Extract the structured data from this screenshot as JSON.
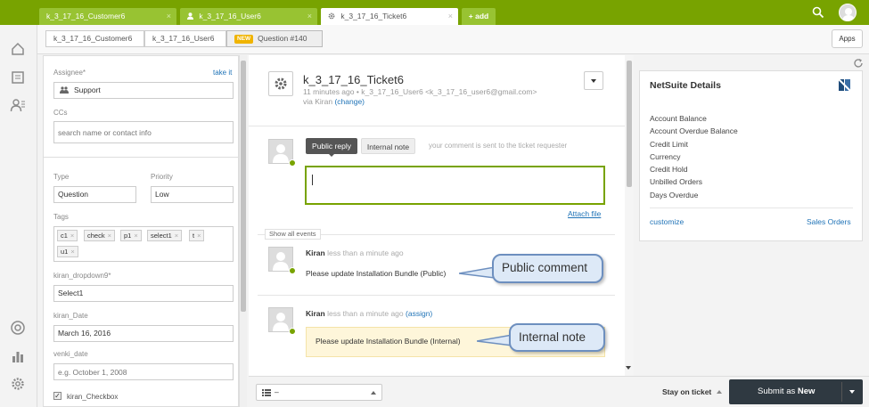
{
  "tabs": [
    {
      "label": "k_3_17_16_Customer6",
      "close": "×"
    },
    {
      "label": "k_3_17_16_User6",
      "close": "×"
    },
    {
      "label": "k_3_17_16_Ticket6",
      "close": "×"
    }
  ],
  "add_tab_label": "+ add",
  "breadcrumbs": {
    "customer": "k_3_17_16_Customer6",
    "user": "k_3_17_16_User6",
    "new_badge": "NEW",
    "question": "Question #140"
  },
  "apps_label": "Apps",
  "props": {
    "assignee_label": "Assignee*",
    "take_it": "take it",
    "assignee_value": "Support",
    "ccs_label": "CCs",
    "ccs_placeholder": "search name or contact info",
    "type_label": "Type",
    "type_value": "Question",
    "priority_label": "Priority",
    "priority_value": "Low",
    "tags_label": "Tags",
    "tags": [
      "c1",
      "check",
      "p1",
      "select1",
      "t",
      "u1"
    ],
    "tag_close": "×",
    "dropdown_label": "kiran_dropdown9*",
    "dropdown_value": "Select1",
    "date_label": "kiran_Date",
    "date_value": "March 16, 2016",
    "venki_label": "venki_date",
    "venki_placeholder": "e.g. October 1, 2008",
    "checkbox_label": "kiran_Checkbox"
  },
  "ticket": {
    "title": "k_3_17_16_Ticket6",
    "meta_time": "11 minutes ago",
    "meta_sep": "•",
    "meta_user": "k_3_17_16_User6 <k_3_17_16_user6@gmail.com>",
    "via": "via Kiran",
    "change": "(change)"
  },
  "composer": {
    "public_reply": "Public reply",
    "internal_note": "Internal note",
    "hint": "your comment is sent to the ticket requester",
    "attach": "Attach file"
  },
  "show_all_events": "Show all events",
  "events": [
    {
      "author": "Kiran",
      "time": "less than a minute ago",
      "assign": "",
      "body": "Please update Installation Bundle (Public)"
    },
    {
      "author": "Kiran",
      "time": "less than a minute ago",
      "assign": "(assign)",
      "body": "Please update Installation Bundle (Internal)"
    }
  ],
  "callouts": {
    "public": "Public comment",
    "internal": "Internal note"
  },
  "footer": {
    "macro_value": "–",
    "stay_on_ticket": "Stay on ticket",
    "submit_prefix": "Submit as",
    "submit_status": "New"
  },
  "netsuite": {
    "title": "NetSuite Details",
    "fields": [
      "Account Balance",
      "Account Overdue Balance",
      "Credit Limit",
      "Currency",
      "Credit Hold",
      "Unbilled Orders",
      "Days Overdue"
    ],
    "customize": "customize",
    "sales_orders": "Sales Orders"
  },
  "colors": {
    "brand_green": "#78a300",
    "link_blue": "#1f73b7",
    "submit_dark": "#2f3941"
  }
}
